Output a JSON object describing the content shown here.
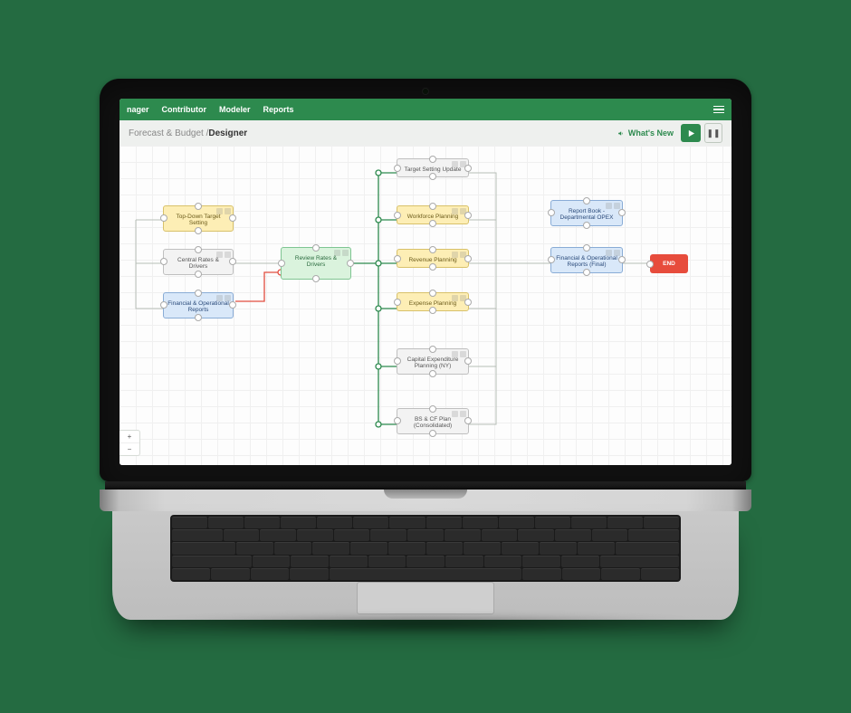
{
  "topbar": {
    "tabs": [
      "nager",
      "Contributor",
      "Modeler",
      "Reports"
    ]
  },
  "subbar": {
    "breadcrumb_prefix": "Forecast & Budget / ",
    "breadcrumb_current": "Designer",
    "whats_new": "What's New"
  },
  "controls": {
    "play_tooltip": "Play",
    "pause_glyph": "❚❚"
  },
  "zoom": {
    "plus": "+",
    "minus": "−"
  },
  "nodes": {
    "top_down": "Top-Down Target Setting",
    "central": "Central Rates & Drivers",
    "fin_ops": "Financial & Operational Reports",
    "review": "Review Rates & Drivers",
    "target_update": "Target Setting Update",
    "workforce": "Workforce Planning",
    "revenue": "Revenue Planning",
    "expense": "Expense Planning",
    "capex": "Capital Expenditure Planning (NY)",
    "bs_cf": "BS & CF Plan (Consolidated)",
    "report_book": "Report Book - Departmental OPEX",
    "final_reports": "Financial & Operational Reports (Final)",
    "end": "END"
  }
}
